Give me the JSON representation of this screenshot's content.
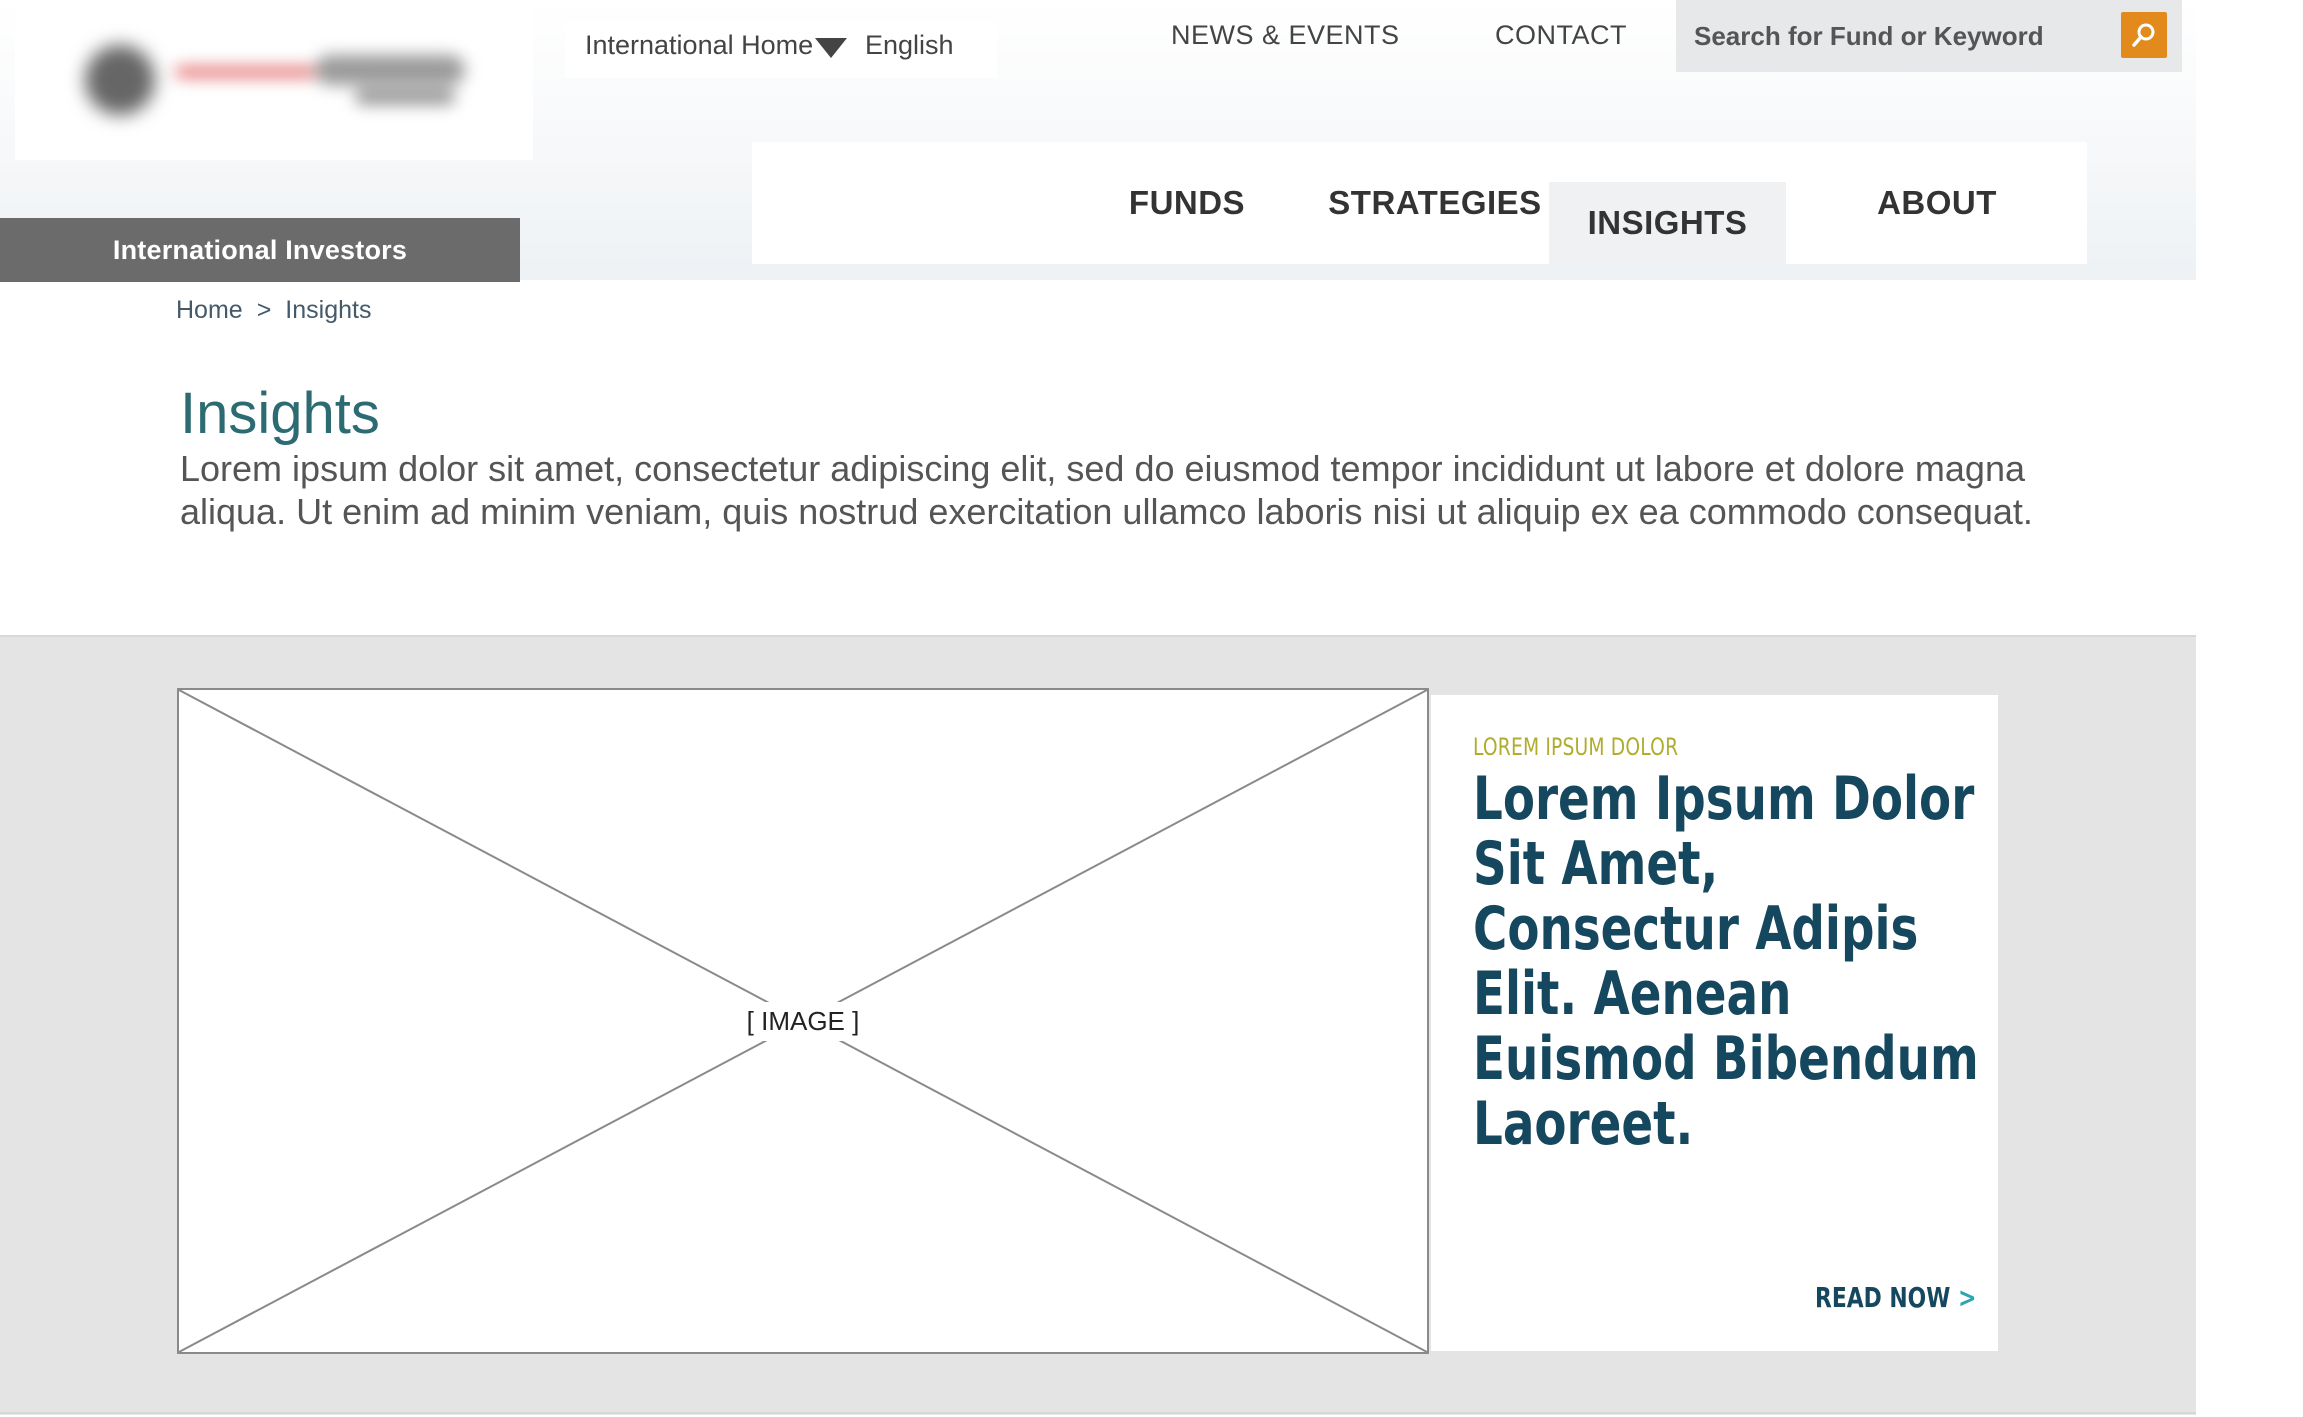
{
  "header": {
    "international_investors": "International Investors",
    "international_home": "International Home",
    "language": "English",
    "news_events": "NEWS & EVENTS",
    "contact": "CONTACT",
    "search_placeholder": "Search for Fund or Keyword"
  },
  "nav": {
    "items": [
      {
        "label": "FUNDS"
      },
      {
        "label": "STRATEGIES"
      },
      {
        "label": "INSIGHTS",
        "active": true
      },
      {
        "label": "ABOUT"
      }
    ]
  },
  "breadcrumb": {
    "home": "Home",
    "separator": ">",
    "current": "Insights"
  },
  "page": {
    "title": "Insights",
    "intro": "Lorem ipsum dolor sit amet, consectetur adipiscing elit, sed do eiusmod tempor incididunt ut labore et dolore magna aliqua. Ut enim ad minim veniam, quis nostrud exercitation ullamco laboris nisi ut aliquip ex ea commodo consequat."
  },
  "feature": {
    "image_label": "[ IMAGE ]",
    "eyebrow": "LOREM IPSUM DOLOR",
    "headline": "Lorem Ipsum Dolor Sit Amet, Consectur Adipis Elit. Aenean Euismod Bibendum Laoreet.",
    "cta": "READ NOW",
    "cta_icon": ">"
  },
  "colors": {
    "accent_orange": "#e38a1c",
    "title_teal": "#2d6b73",
    "headline_navy": "#15475e",
    "eyebrow_olive": "#b0ad2e",
    "chevron_teal": "#2aa5b3",
    "investors_bar": "#6b6b6b"
  },
  "icons": {
    "search": "search-icon",
    "dropdown": "caret-down-icon",
    "cta": "chevron-right-icon"
  }
}
